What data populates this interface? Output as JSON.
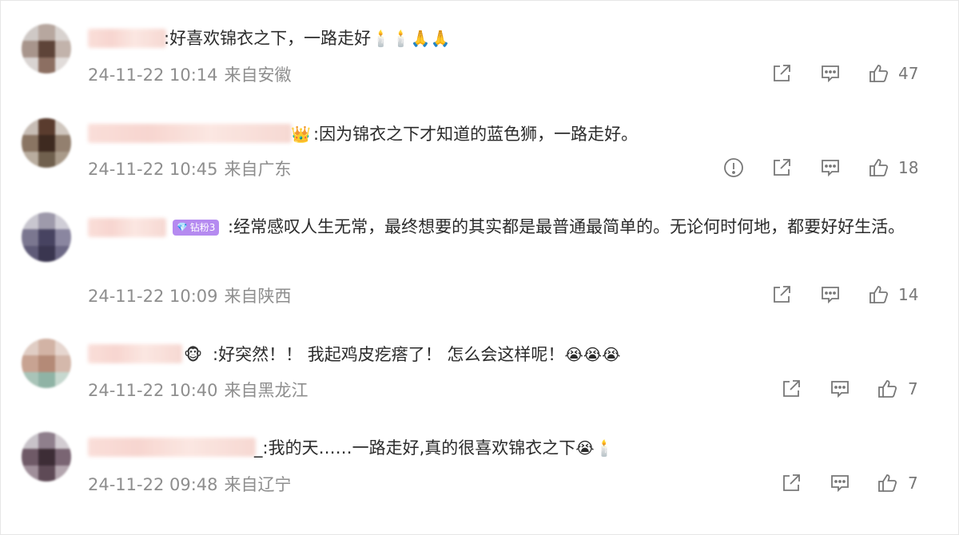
{
  "comments": [
    {
      "text": ":好喜欢锦衣之下，一路走好",
      "emojis": "🕯️🕯️🙏🙏",
      "date": "24-11-22 10:14",
      "location": "来自安徽",
      "likes": "47",
      "has_report": false
    },
    {
      "text": ":因为锦衣之下才知道的蓝色狮，一路走好。",
      "emojis": "",
      "badge_emoji": "👑",
      "date": "24-11-22 10:45",
      "location": "来自广东",
      "likes": "18",
      "has_report": true
    },
    {
      "fan_badge": "钻粉3",
      "text": ":经常感叹人生无常，最终想要的其实都是最普通最简单的。无论何时何地，都要好好生活。",
      "emojis": "",
      "date": "24-11-22 10:09",
      "location": "来自陕西",
      "likes": "14",
      "has_report": false
    },
    {
      "badge_emoji": "🐵",
      "text": ":好突然！！ 我起鸡皮疙瘩了！ 怎么会这样呢！",
      "emojis": "😭😭😭",
      "date": "24-11-22 10:40",
      "location": "来自黑龙江",
      "likes": "7",
      "has_report": false
    },
    {
      "text": "_:我的天……一路走好,真的很喜欢锦衣之下",
      "emojis": "😭🕯️",
      "date": "24-11-22 09:48",
      "location": "来自辽宁",
      "likes": "7",
      "has_report": false
    }
  ],
  "icons": {
    "share": "share-icon",
    "comment": "comment-icon",
    "like": "like-icon",
    "report": "report-icon"
  },
  "colors": {
    "text": "#2b2b2b",
    "meta": "#8e8e8e",
    "icon": "#777777",
    "fan_badge": "#b58af0"
  }
}
